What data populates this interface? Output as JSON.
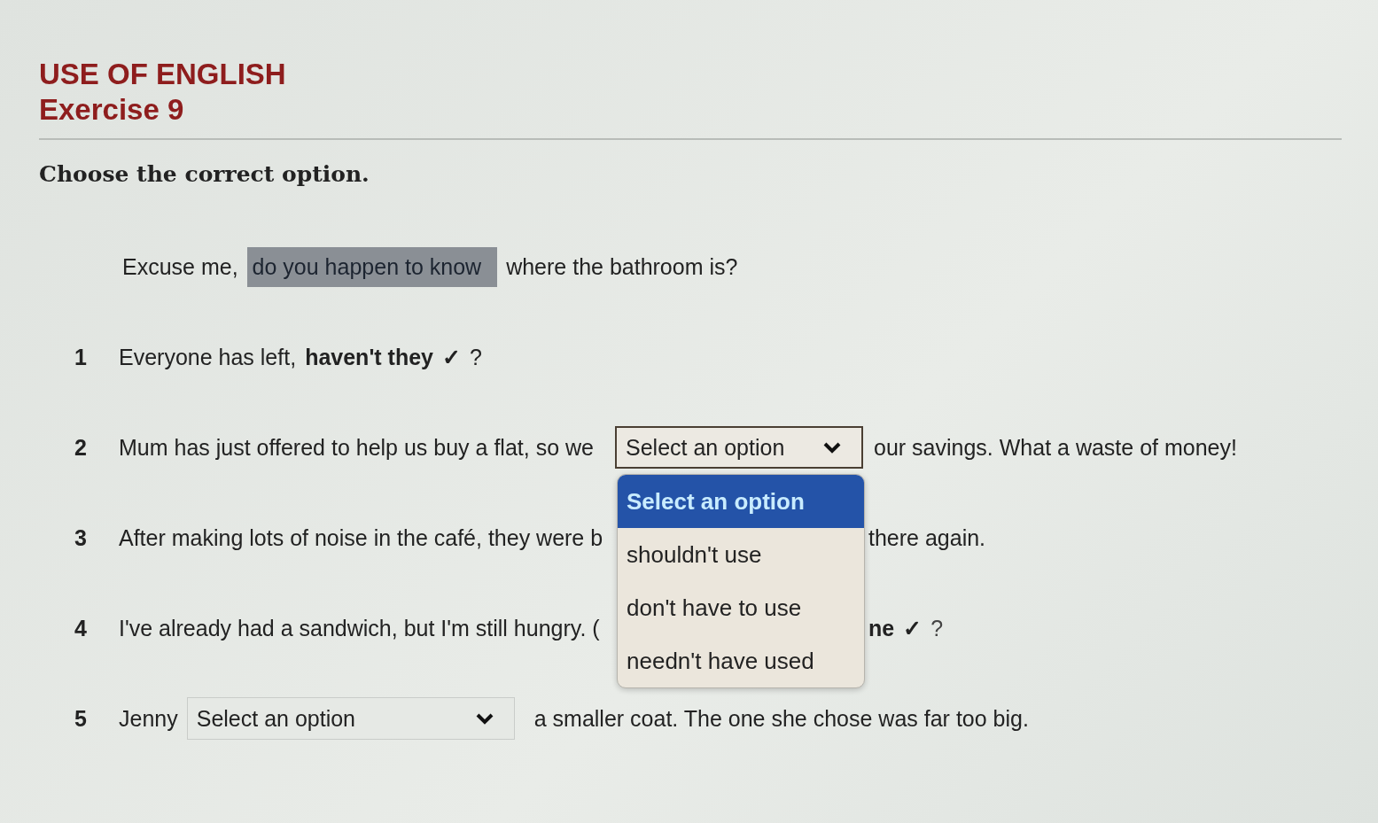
{
  "header": {
    "section": "USE OF ENGLISH",
    "exercise": "Exercise 9"
  },
  "instruction": "Choose the correct option.",
  "example": {
    "before": "Excuse me,",
    "answer": "do you happen to know",
    "after": "where the bathroom is?"
  },
  "items": [
    {
      "number": "1",
      "kind": "answered",
      "before": "Everyone has left,",
      "answer": "haven't they",
      "mark": "✓",
      "after": "?"
    },
    {
      "number": "2",
      "kind": "select",
      "before": "Mum has just offered to help us buy a flat, so we",
      "value": "Select an option",
      "open": true,
      "options": [
        {
          "label": "Select an option",
          "selected": true
        },
        {
          "label": "shouldn't use",
          "selected": false
        },
        {
          "label": "don't have to use",
          "selected": false
        },
        {
          "label": "needn't have used",
          "selected": false
        }
      ],
      "after": "our savings. What a waste of money!"
    },
    {
      "number": "3",
      "kind": "covered",
      "before": "After making lots of noise in the café, they were b",
      "after": "there again."
    },
    {
      "number": "4",
      "kind": "covered",
      "before": "I've already had a sandwich, but I'm still hungry. (",
      "answer": "ne",
      "mark": "✓",
      "after": "?"
    },
    {
      "number": "5",
      "kind": "select",
      "before": "Jenny",
      "value": "Select an option",
      "open": false,
      "after": "a smaller coat. The one she chose was far too big."
    }
  ]
}
